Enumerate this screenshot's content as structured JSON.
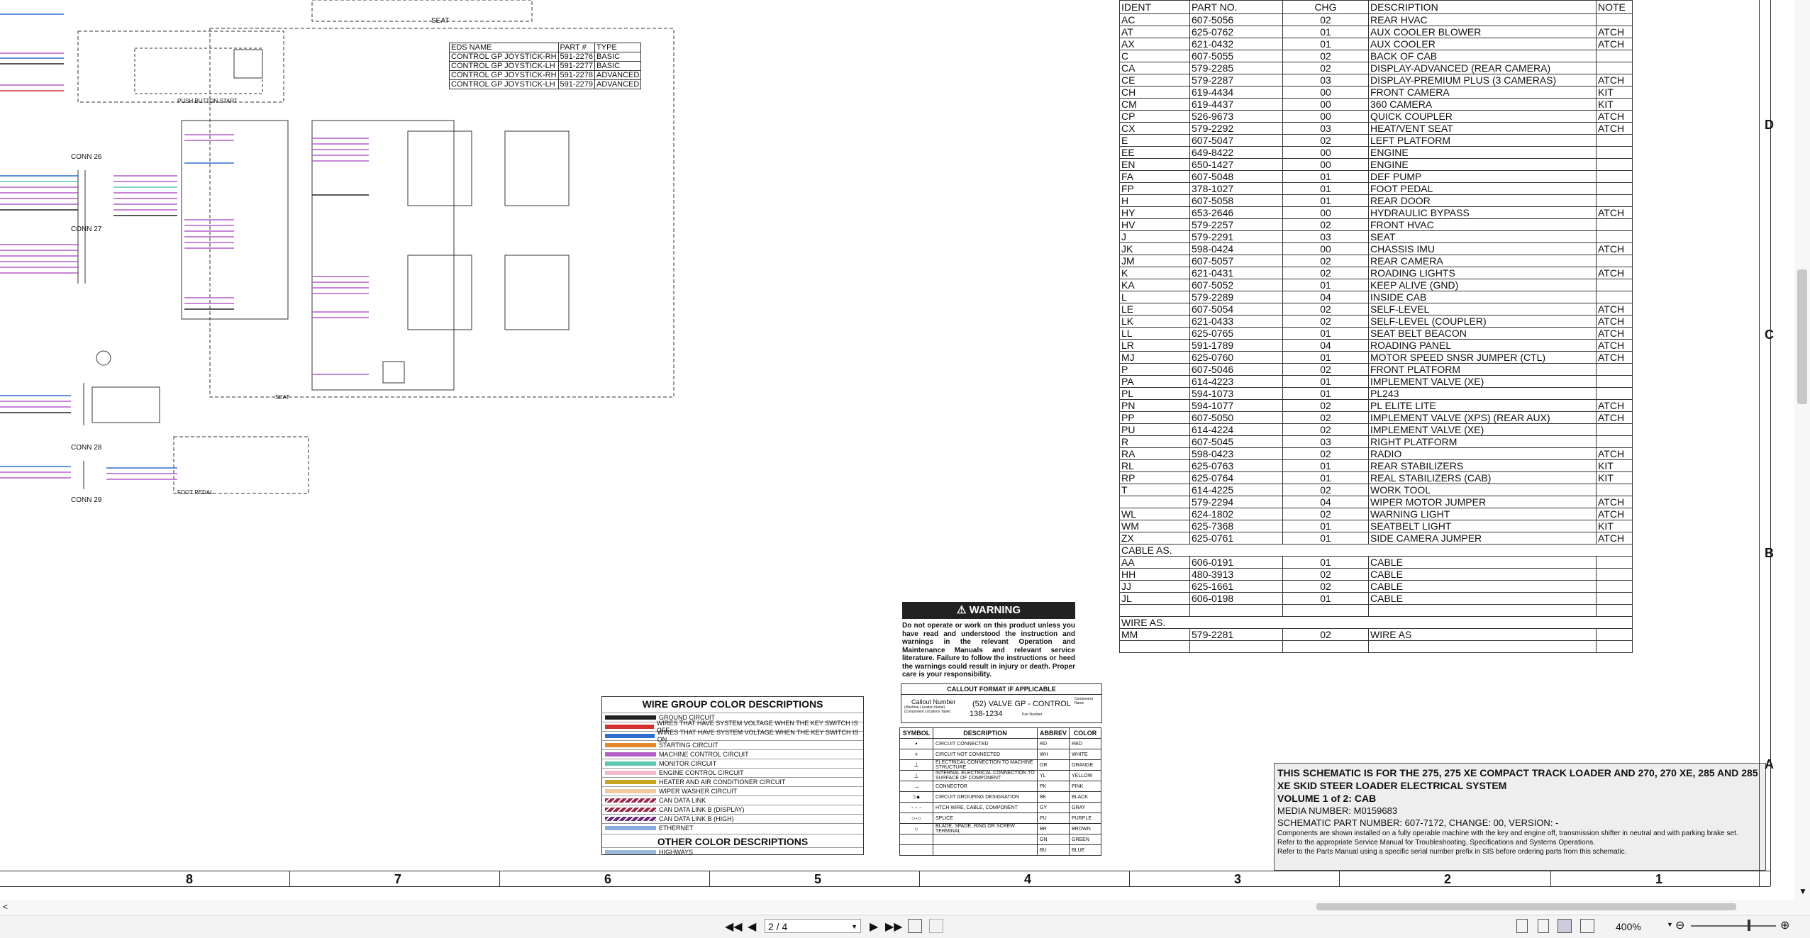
{
  "eds": {
    "headers": [
      "EDS NAME",
      "PART #",
      "TYPE"
    ],
    "rows": [
      [
        "CONTROL GP JOYSTICK-RH",
        "591-2276",
        "BASIC"
      ],
      [
        "CONTROL GP JOYSTICK-LH",
        "591-2277",
        "BASIC"
      ],
      [
        "CONTROL GP JOYSTICK-RH",
        "591-2278",
        "ADVANCED"
      ],
      [
        "CONTROL GP JOYSTICK-LH",
        "591-2279",
        "ADVANCED"
      ]
    ]
  },
  "schem_labels": {
    "seat": "SEAT",
    "conn26": "CONN 26",
    "conn27": "CONN 27",
    "conn28": "CONN 28",
    "conn29": "CONN 29",
    "push_button_start": "PUSH BUTTON START",
    "foot_pedal": "FOOT PEDAL",
    "seat2": "SEAT"
  },
  "parts": {
    "headers": [
      "IDENT",
      "PART NO.",
      "CHG",
      "DESCRIPTION",
      "NOTE"
    ],
    "rows": [
      [
        "AC",
        "607-5056",
        "02",
        "REAR HVAC",
        ""
      ],
      [
        "AT",
        "625-0762",
        "01",
        "AUX COOLER BLOWER",
        "ATCH"
      ],
      [
        "AX",
        "621-0432",
        "01",
        "AUX COOLER",
        "ATCH"
      ],
      [
        "C",
        "607-5055",
        "02",
        "BACK OF CAB",
        ""
      ],
      [
        "CA",
        "579-2285",
        "02",
        "DISPLAY-ADVANCED (REAR CAMERA)",
        ""
      ],
      [
        "CE",
        "579-2287",
        "03",
        "DISPLAY-PREMIUM PLUS  (3 CAMERAS)",
        "ATCH"
      ],
      [
        "CH",
        "619-4434",
        "00",
        "FRONT CAMERA",
        "KIT"
      ],
      [
        "CM",
        "619-4437",
        "00",
        "360 CAMERA",
        "KIT"
      ],
      [
        "CP",
        "526-9673",
        "00",
        "QUICK COUPLER",
        "ATCH"
      ],
      [
        "CX",
        "579-2292",
        "03",
        "HEAT/VENT SEAT",
        "ATCH"
      ],
      [
        "E",
        "607-5047",
        "02",
        "LEFT PLATFORM",
        ""
      ],
      [
        "EE",
        "649-8422",
        "00",
        "ENGINE",
        ""
      ],
      [
        "EN",
        "650-1427",
        "00",
        "ENGINE",
        ""
      ],
      [
        "FA",
        "607-5048",
        "01",
        "DEF PUMP",
        ""
      ],
      [
        "FP",
        "378-1027",
        "01",
        "FOOT PEDAL",
        ""
      ],
      [
        "H",
        "607-5058",
        "01",
        "REAR DOOR",
        ""
      ],
      [
        "HY",
        "653-2646",
        "00",
        "HYDRAULIC BYPASS",
        "ATCH"
      ],
      [
        "HV",
        "579-2257",
        "02",
        "FRONT HVAC",
        ""
      ],
      [
        "J",
        "579-2291",
        "03",
        "SEAT",
        ""
      ],
      [
        "JK",
        "598-0424",
        "00",
        "CHASSIS IMU",
        "ATCH"
      ],
      [
        "JM",
        "607-5057",
        "02",
        "REAR CAMERA",
        ""
      ],
      [
        "K",
        "621-0431",
        "02",
        "ROADING LIGHTS",
        "ATCH"
      ],
      [
        "KA",
        "607-5052",
        "01",
        "KEEP ALIVE (GND)",
        ""
      ],
      [
        "L",
        "579-2289",
        "04",
        "INSIDE CAB",
        ""
      ],
      [
        "LE",
        "607-5054",
        "02",
        "SELF-LEVEL",
        "ATCH"
      ],
      [
        "LK",
        "621-0433",
        "02",
        "SELF-LEVEL (COUPLER)",
        "ATCH"
      ],
      [
        "LL",
        "625-0765",
        "01",
        "SEAT BELT BEACON",
        "ATCH"
      ],
      [
        "LR",
        "591-1789",
        "04",
        "ROADING PANEL",
        "ATCH"
      ],
      [
        "MJ",
        "625-0760",
        "01",
        "MOTOR SPEED SNSR JUMPER (CTL)",
        "ATCH"
      ],
      [
        "P",
        "607-5046",
        "02",
        "FRONT PLATFORM",
        ""
      ],
      [
        "PA",
        "614-4223",
        "01",
        "IMPLEMENT VALVE (XE)",
        ""
      ],
      [
        "PL",
        "594-1073",
        "01",
        "PL243",
        ""
      ],
      [
        "PN",
        "594-1077",
        "02",
        "PL ELITE LITE",
        "ATCH"
      ],
      [
        "PP",
        "607-5050",
        "02",
        "IMPLEMENT VALVE (XPS) (REAR AUX)",
        "ATCH"
      ],
      [
        "PU",
        "614-4224",
        "02",
        "IMPLEMENT VALVE (XE)",
        ""
      ],
      [
        "R",
        "607-5045",
        "03",
        "RIGHT PLATFORM",
        ""
      ],
      [
        "RA",
        "598-0423",
        "02",
        "RADIO",
        "ATCH"
      ],
      [
        "RL",
        "625-0763",
        "01",
        "REAR STABILIZERS",
        "KIT"
      ],
      [
        "RP",
        "625-0764",
        "01",
        "REAL STABILIZERS (CAB)",
        "KIT"
      ],
      [
        "T",
        "614-4225",
        "02",
        "WORK TOOL",
        ""
      ],
      [
        "",
        "579-2294",
        "04",
        "WIPER MOTOR JUMPER",
        "ATCH"
      ],
      [
        "WL",
        "624-1802",
        "02",
        "WARNING LIGHT",
        "ATCH"
      ],
      [
        "WM",
        "625-7368",
        "01",
        "SEATBELT LIGHT",
        "KIT"
      ],
      [
        "ZX",
        "625-0761",
        "01",
        "SIDE CAMERA JUMPER",
        "ATCH"
      ]
    ],
    "cable_label": "CABLE AS.",
    "cable_rows": [
      [
        "AA",
        "606-0191",
        "01",
        "CABLE",
        ""
      ],
      [
        "HH",
        "480-3913",
        "02",
        "CABLE",
        ""
      ],
      [
        "JJ",
        "625-1661",
        "02",
        "CABLE",
        ""
      ],
      [
        "JL",
        "606-0198",
        "01",
        "CABLE",
        ""
      ]
    ],
    "wire_label": "WIRE AS.",
    "wire_rows": [
      [
        "MM",
        "579-2281",
        "02",
        "WIRE AS",
        ""
      ]
    ]
  },
  "warning": {
    "title": "WARNING",
    "text": "Do not operate or work on this product unless you have read and understood the instruction and warnings in the relevant Operation and Maintenance Manuals and relevant service literature. Failure to follow the instructions or heed the warnings could result in injury or death. Proper care is your responsibility."
  },
  "callout": {
    "title": "CALLOUT FORMAT IF APPLICABLE",
    "callout_number": "Callout Number",
    "callout_sub": "(Machine Location Name) (Component Locations Table)",
    "example_line1": "(52) VALVE GP - CONTROL",
    "example_line2": "138-1234",
    "component_name": "Component Name",
    "part_number": "Part Number"
  },
  "symbols": {
    "headers": [
      "SYMBOL",
      "DESCRIPTION",
      "ABBREV",
      "COLOR"
    ],
    "rows": [
      [
        "CIRCUIT CONNECTED",
        "RD",
        "RED"
      ],
      [
        "CIRCUIT NOT CONNECTED",
        "WH",
        "WHITE"
      ],
      [
        "ELECTRICAL CONNECTION TO MACHINE STRUCTURE",
        "OR",
        "ORANGE"
      ],
      [
        "INTERNAL ELECTRICAL CONNECTION TO SURFACE OF COMPONENT",
        "YL",
        "YELLOW"
      ],
      [
        "CONNECTOR",
        "PK",
        "PINK"
      ],
      [
        "CIRCUIT GROUPING DESIGNATION",
        "BK",
        "BLACK"
      ],
      [
        "HTCH WIRE, CABLE, COMPONENT",
        "GY",
        "GRAY"
      ],
      [
        "SPLICE",
        "PU",
        "PURPLE"
      ],
      [
        "BLADE, SPADE, RING OR SCREW TERMINAL",
        "BR",
        "BROWN"
      ],
      [
        "",
        "GN",
        "GREEN"
      ],
      [
        "",
        "BU",
        "BLUE"
      ]
    ]
  },
  "wire_colors": {
    "title": "WIRE GROUP COLOR DESCRIPTIONS",
    "rows": [
      {
        "label": "GROUND CIRCUIT",
        "color": "#222222"
      },
      {
        "label": "WIRES THAT HAVE SYSTEM VOLTAGE WHEN THE KEY SWITCH IS OFF",
        "color": "#d43030"
      },
      {
        "label": "WIRES THAT HAVE SYSTEM VOLTAGE WHEN THE KEY SWITCH IS ON",
        "color": "#2f6fd1"
      },
      {
        "label": "STARTING CIRCUIT",
        "color": "#e3892b"
      },
      {
        "label": "MACHINE CONTROL CIRCUIT",
        "color": "#b45fc8"
      },
      {
        "label": "MONITOR CIRCUIT",
        "color": "#5fc7b0"
      },
      {
        "label": "ENGINE CONTROL CIRCUIT",
        "color": "#f2b9cf"
      },
      {
        "label": "HEATER AND AIR CONDITIONER CIRCUIT",
        "color": "#c8a41c"
      },
      {
        "label": "WIPER WASHER CIRCUIT",
        "color": "#f0c9a3"
      },
      {
        "label": "CAN DATA LINK",
        "color": "#9b2a4a"
      },
      {
        "label": "CAN DATA LINK B (DISPLAY)",
        "color": "#9b2a4a"
      },
      {
        "label": "CAN DATA LINK B (HIGH)",
        "color": "#6b2a7a"
      },
      {
        "label": "ETHERNET",
        "color": "#88aadd"
      }
    ],
    "other_title": "OTHER COLOR DESCRIPTIONS",
    "other_rows": [
      {
        "label": "HIGHWAYS",
        "color": "#a0b8d8"
      }
    ]
  },
  "title_block": {
    "line1": "THIS SCHEMATIC IS FOR THE 275, 275 XE COMPACT TRACK LOADER AND 270, 270 XE, 285 AND 285 XE SKID STEER LOADER ELECTRICAL SYSTEM",
    "line2": "VOLUME 1 of 2: CAB",
    "media": "MEDIA NUMBER: M0159683",
    "part": "SCHEMATIC PART NUMBER: 607-7172, CHANGE: 00, VERSION: -",
    "note1": "Components are shown installed on a fully operable machine with the key and engine off, transmission shifter in neutral and with parking brake set.",
    "note2": "Refer to the appropriate Service Manual for Troubleshooting, Specifications and Systems Operations.",
    "note3": "Refer to the Parts Manual using a specific serial number prefix in SIS before ordering parts from this schematic."
  },
  "grid": {
    "columns": [
      "8",
      "7",
      "6",
      "5",
      "4",
      "3",
      "2",
      "1"
    ],
    "rows": [
      "D",
      "C",
      "B",
      "A"
    ]
  },
  "viewer": {
    "page_value": "2 / 4",
    "zoom": "400%"
  }
}
